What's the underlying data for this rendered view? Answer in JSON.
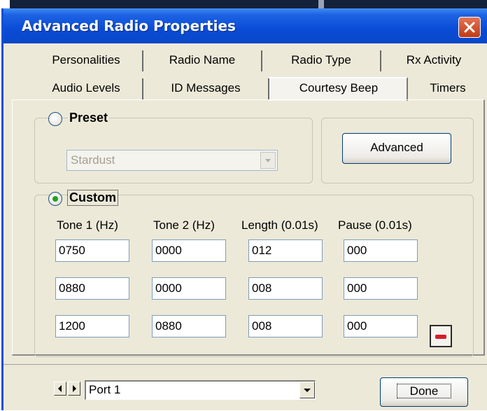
{
  "window": {
    "title": "Advanced Radio Properties"
  },
  "tabs": {
    "row1": [
      "Personalities",
      "Radio Name",
      "Radio Type",
      "Rx Activity"
    ],
    "row2": [
      "Audio Levels",
      "ID Messages",
      "Courtesy Beep",
      "Timers"
    ],
    "active": "Courtesy Beep"
  },
  "preset": {
    "label": "Preset",
    "selected": false,
    "combo_value": "Stardust",
    "advanced_button": "Advanced"
  },
  "custom": {
    "label": "Custom",
    "selected": true,
    "columns": [
      "Tone 1 (Hz)",
      "Tone 2 (Hz)",
      "Length (0.01s)",
      "Pause (0.01s)"
    ],
    "rows": [
      [
        "0750",
        "0000",
        "012",
        "000"
      ],
      [
        "0880",
        "0000",
        "008",
        "000"
      ],
      [
        "1200",
        "0880",
        "008",
        "000"
      ]
    ]
  },
  "footer": {
    "port_value": "Port 1",
    "done_button": "Done"
  },
  "icons": {
    "close": "close-icon",
    "remove": "minus-icon",
    "prev": "arrow-left-icon",
    "next": "arrow-right-icon",
    "dropdown": "chevron-down-icon"
  },
  "colors": {
    "title_bar": "#0a4bd6",
    "close_button": "#d2451e",
    "radio_selected": "#21a121",
    "remove_button": "#d3202a"
  }
}
